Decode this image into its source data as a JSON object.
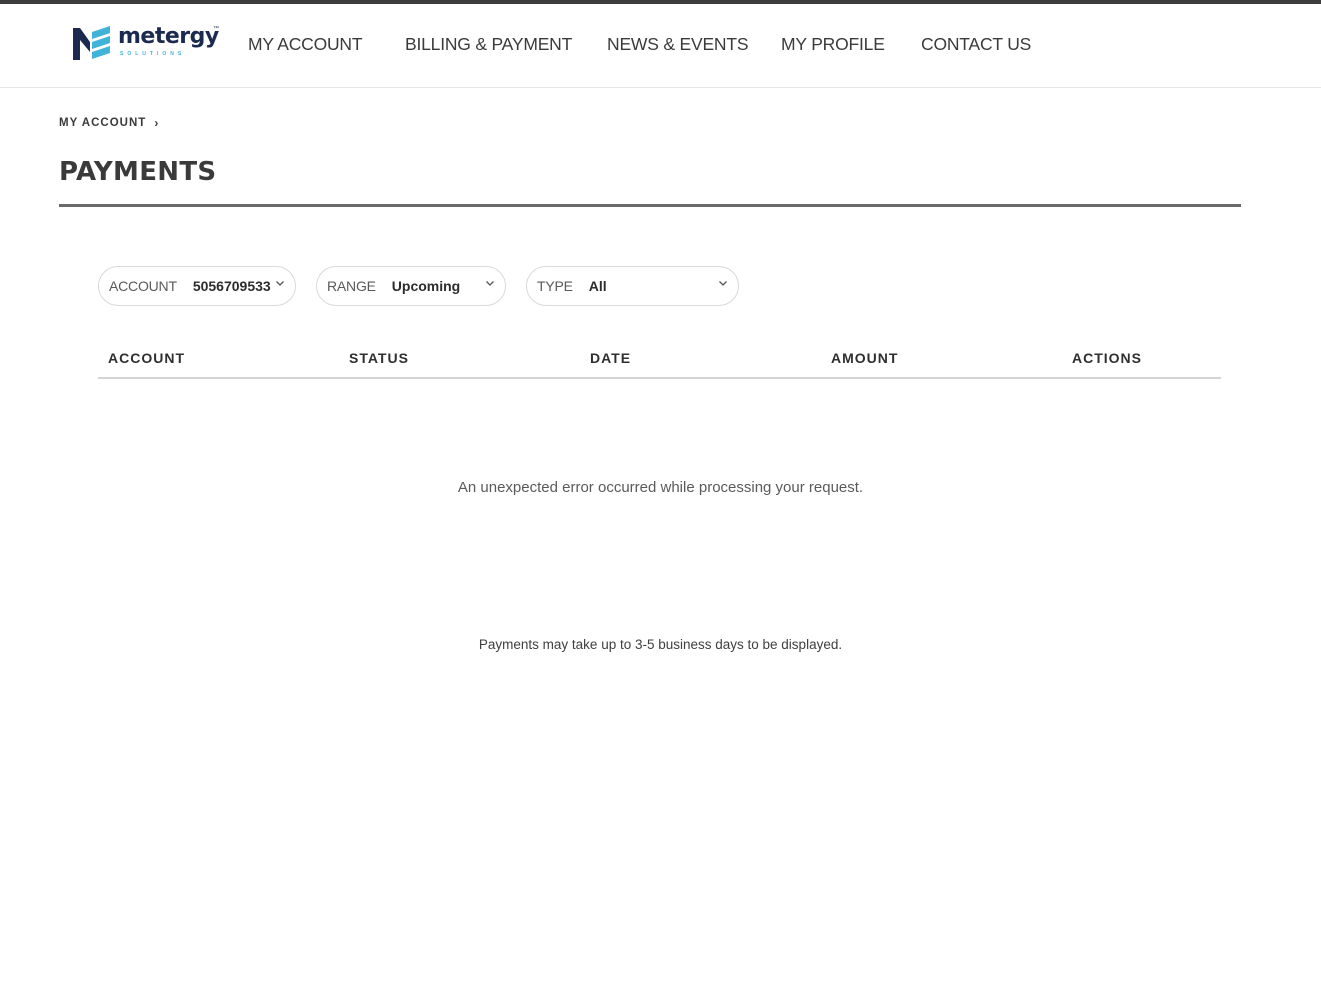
{
  "brand": {
    "name": "metergy",
    "tagline": "SOLUTIONS",
    "colors": {
      "navy": "#1b2a4e",
      "teal": "#3fb3d8"
    }
  },
  "nav": {
    "items": [
      {
        "label": "MY ACCOUNT"
      },
      {
        "label": "BILLING & PAYMENT"
      },
      {
        "label": "NEWS & EVENTS"
      },
      {
        "label": "MY PROFILE"
      },
      {
        "label": "CONTACT US"
      }
    ]
  },
  "breadcrumb": {
    "label": "MY ACCOUNT",
    "icon": "chevron-right-icon"
  },
  "page": {
    "title": "PAYMENTS"
  },
  "filters": {
    "account": {
      "label": "ACCOUNT",
      "value": "5056709533"
    },
    "range": {
      "label": "RANGE",
      "value": "Upcoming"
    },
    "type": {
      "label": "TYPE",
      "value": "All"
    }
  },
  "table": {
    "columns": [
      "ACCOUNT",
      "STATUS",
      "DATE",
      "AMOUNT",
      "ACTIONS"
    ],
    "rows": []
  },
  "messages": {
    "error": "An unexpected error occurred while processing your request.",
    "note": "Payments may take up to 3-5 business days to be displayed."
  }
}
